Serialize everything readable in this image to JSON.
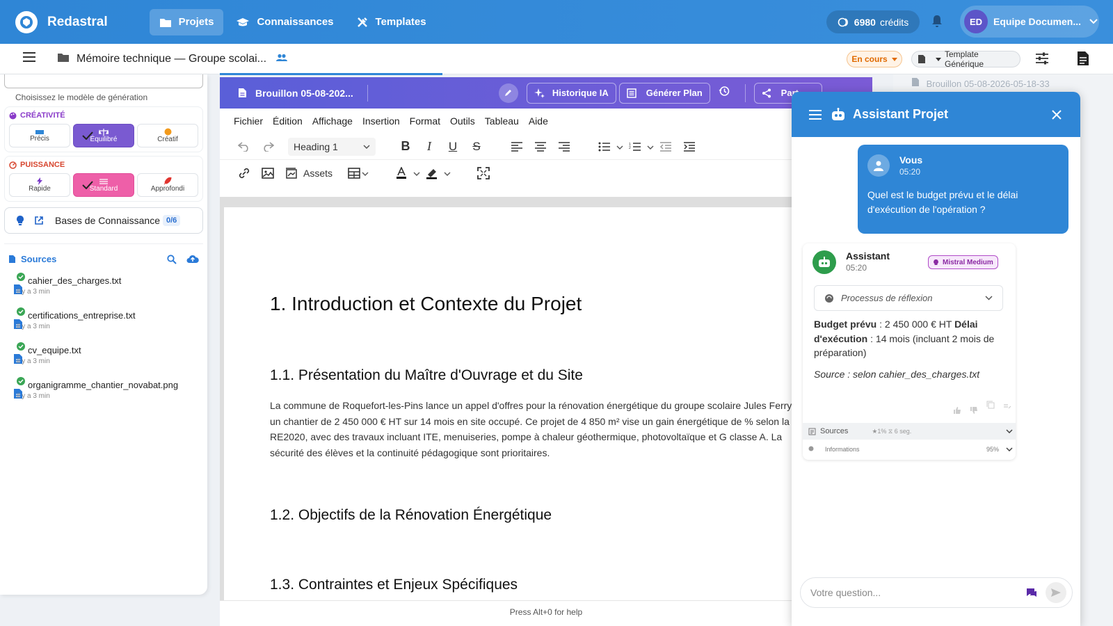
{
  "app": {
    "name": "Redastral"
  },
  "nav": {
    "items": [
      {
        "label": "Projets",
        "icon": "folder-icon",
        "active": true
      },
      {
        "label": "Connaissances",
        "icon": "graduation-cap-icon",
        "active": false
      },
      {
        "label": "Templates",
        "icon": "tools-icon",
        "active": false
      }
    ]
  },
  "credits": {
    "value": "6980",
    "unit": "crédits"
  },
  "account": {
    "initials": "ED",
    "name": "Equipe Documen..."
  },
  "doc": {
    "title": "Mémoire technique — Groupe scolai...",
    "status": "En cours",
    "template": "Template Générique"
  },
  "left": {
    "model_hint": "Choisissez le modèle de génération",
    "creativity": {
      "title": "CRÉATIVITÉ",
      "options": [
        "Précis",
        "Équilibré",
        "Créatif"
      ],
      "selected": 1
    },
    "power": {
      "title": "PUISSANCE",
      "options": [
        "Rapide",
        "Standard",
        "Approfondi"
      ],
      "selected": 1
    },
    "kb": {
      "label": "Bases de Connaissance",
      "count": "0/6"
    },
    "sources": {
      "title": "Sources",
      "files": [
        {
          "name": "cahier_des_charges.txt",
          "time": "il y a 3 min"
        },
        {
          "name": "certifications_entreprise.txt",
          "time": "il y a 3 min"
        },
        {
          "name": "cv_equipe.txt",
          "time": "il y a 3 min"
        },
        {
          "name": "organigramme_chantier_novabat.png",
          "time": "il y a 3 min"
        }
      ]
    }
  },
  "editor": {
    "draft_title": "Brouillon 05-08-202...",
    "history_label": "Historique IA",
    "plan_label": "Générer Plan",
    "share_label": "Part",
    "menu": [
      "Fichier",
      "Édition",
      "Affichage",
      "Insertion",
      "Format",
      "Outils",
      "Tableau",
      "Aide"
    ],
    "heading_select": "Heading 1",
    "assets_label": "Assets",
    "h1": "1. Introduction et Contexte du Projet",
    "h2_1": "1.1. Présentation du Maître d'Ouvrage et du Site",
    "paragraph": "La commune de Roquefort-les-Pins lance un appel d'offres pour la rénovation énergétique du groupe scolaire Jules Ferry, un chantier de 2 450 000 € HT sur 14 mois en site occupé. Ce projet de 4 850 m² vise un gain énergétique de % selon la RE2020, avec des travaux incluant ITE, menuiseries, pompe à chaleur géothermique, photovoltaïque et G classe A. La sécurité des élèves et la continuité pédagogique sont prioritaires.",
    "h2_2": "1.2. Objectifs de la Rénovation Énergétique",
    "h2_3": "1.3. Contraintes et Enjeux Spécifiques",
    "help": "Press Alt+0 for help"
  },
  "right_draft": "Brouillon 05-08-2026-05-18-33",
  "chat": {
    "title": "Assistant Projet",
    "user": {
      "name": "Vous",
      "time": "05:20",
      "message": "Quel est le budget prévu et le délai d'exécution de l'opération ?"
    },
    "assistant": {
      "name": "Assistant",
      "time": "05:20",
      "model": "Mistral Medium",
      "reasoning": "Processus de réflexion",
      "budget_label": "Budget prévu",
      "budget_value": " : 2 450 000 € HT ",
      "delay_label": "Délai d'exécution",
      "delay_value": " : 14 mois (incluant 2 mois de préparation)",
      "source": "Source : selon cahier_des_charges.txt",
      "sources_label": "Sources",
      "sources_stats": "★1%  ⧖ 6 seg.",
      "info_label": "Informations",
      "info_value": "95%"
    },
    "input_placeholder": "Votre question..."
  },
  "colors": {
    "primary": "#2f86d6",
    "editor_header": "#6a5cd6",
    "status": "#e06a00",
    "model_pill": "#8b2aa3"
  }
}
